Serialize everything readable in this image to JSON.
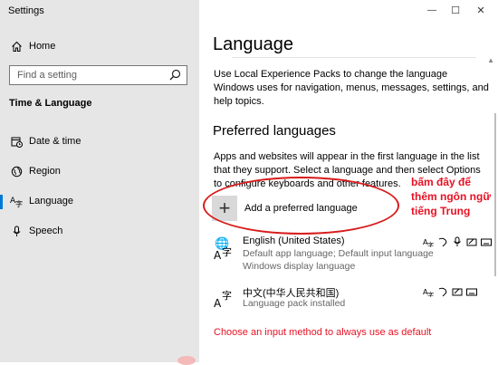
{
  "window": {
    "app_title": "Settings",
    "controls": {
      "minimize": "—",
      "maximize": "☐",
      "close": "✕"
    }
  },
  "sidebar": {
    "home_label": "Home",
    "search_placeholder": "Find a setting",
    "section_title": "Time & Language",
    "items": [
      {
        "label": "Date & time",
        "icon": "calendar-clock-icon"
      },
      {
        "label": "Region",
        "icon": "globe-icon"
      },
      {
        "label": "Language",
        "icon": "language-icon",
        "active": true
      },
      {
        "label": "Speech",
        "icon": "microphone-icon"
      }
    ]
  },
  "main": {
    "title": "Language",
    "intro": "Use Local Experience Packs to change the language Windows uses for navigation, menus, messages, settings, and help topics.",
    "preferred_title": "Preferred languages",
    "preferred_desc": "Apps and websites will appear in the first language in the list that they support. Select a language and then select Options to configure keyboards and other features.",
    "add_label": "Add a preferred language",
    "languages": [
      {
        "name": "English (United States)",
        "line1": "Default app language; Default input language",
        "line2": "Windows display language"
      },
      {
        "name": "中文(中华人民共和国)",
        "line1": "Language pack installed"
      }
    ],
    "input_method_link": "Choose an input method to always use as default"
  },
  "annotation": {
    "text": "bấm đây để thêm ngôn ngữ tiếng Trung"
  },
  "colors": {
    "accent": "#0078d7",
    "annotation_red": "#e81123",
    "sidebar_bg": "#e6e6e6"
  }
}
